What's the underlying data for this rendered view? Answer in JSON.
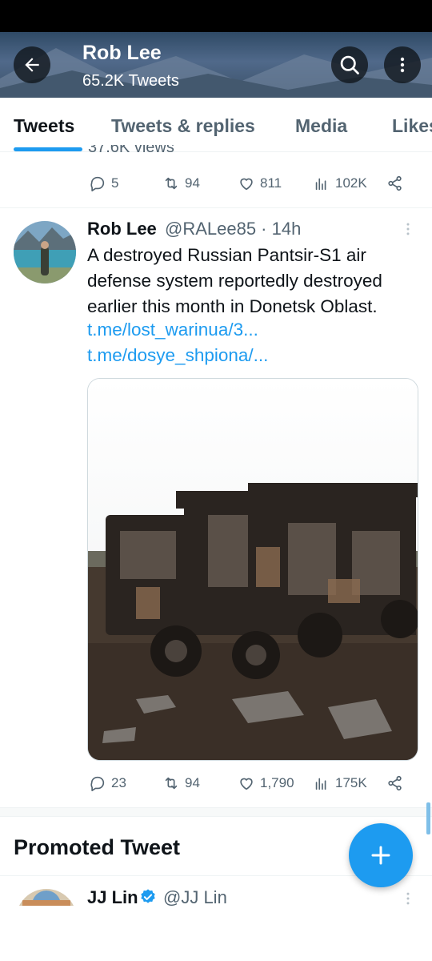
{
  "header": {
    "title": "Rob Lee",
    "subtitle": "65.2K Tweets",
    "back_icon": "arrow-left-icon",
    "search_icon": "search-icon",
    "more_icon": "more-vertical-icon"
  },
  "tabs": [
    {
      "label": "Tweets",
      "active": true
    },
    {
      "label": "Tweets & replies",
      "active": false
    },
    {
      "label": "Media",
      "active": false
    },
    {
      "label": "Likes",
      "active": false
    }
  ],
  "previous_tweet": {
    "views_cutoff_text": "37.6K views",
    "actions": {
      "replies": "5",
      "retweets": "94",
      "likes": "811",
      "views": "102K"
    }
  },
  "tweet": {
    "name": "Rob Lee",
    "handle_time": "@RALee85 · 14h",
    "text": "A destroyed Russian Pantsir-S1 air defense system reportedly destroyed earlier this month in Donetsk Oblast.",
    "links": [
      "t.me/lost_warinua/3...",
      "t.me/dosye_shpiona/..."
    ],
    "actions": {
      "replies": "23",
      "retweets": "94",
      "likes": "1,790",
      "views": "175K"
    }
  },
  "promoted": {
    "title": "Promoted Tweet",
    "name": "JJ Lin",
    "handle": "@JJ Lin"
  },
  "colors": {
    "accent": "#1d9bf0",
    "text_primary": "#0f1419",
    "text_secondary": "#536471",
    "divider": "#eff3f4"
  }
}
